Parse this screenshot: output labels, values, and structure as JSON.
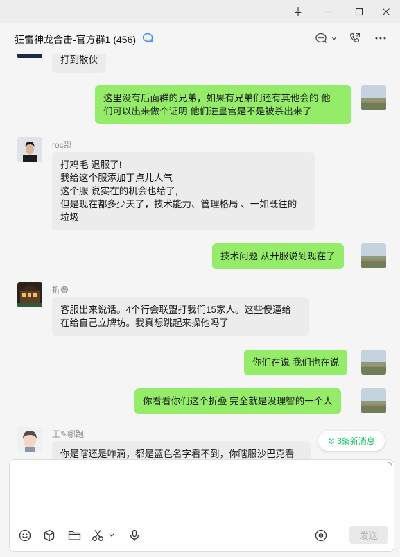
{
  "window": {
    "title": "狂雷神龙合击-官方群1 (456)"
  },
  "messages": [
    {
      "side": "left",
      "text": "打到散伙"
    },
    {
      "side": "right",
      "text": "这里没有后面群的兄弟，如果有兄弟们还有其他会的  他\n们可以出来做个证明 他们进皇宫是不是被杀出来了"
    },
    {
      "side": "left",
      "sender": "roc邵",
      "text": "打鸡毛  退服了!\n我给这个服添加丁点儿人气\n这个服  说实在的机会也给了,\n但是现在都多少天了，技术能力、管理格局 、一如既往的\n垃圾"
    },
    {
      "side": "right",
      "text": "技术问题  从开服说到现在了"
    },
    {
      "side": "left",
      "sender": "折叠",
      "text": "客服出来说话。4个行会联盟打我们15家人。这些傻逼给\n在给自己立牌坊。我真想跳起来操他吗了"
    },
    {
      "side": "right",
      "text": "你们在说 我们也在说"
    },
    {
      "side": "right",
      "text": "你看看你们这个折叠  完全就是没理智的一个人"
    },
    {
      "side": "left",
      "sender": "王✎哪跑",
      "text": "你是瞎还是咋滴，都是蓝色名字看不到，你瞎服沙巴克看"
    }
  ],
  "new_messages": {
    "label": "3条新消息"
  },
  "composer": {
    "send_label": "发送"
  }
}
